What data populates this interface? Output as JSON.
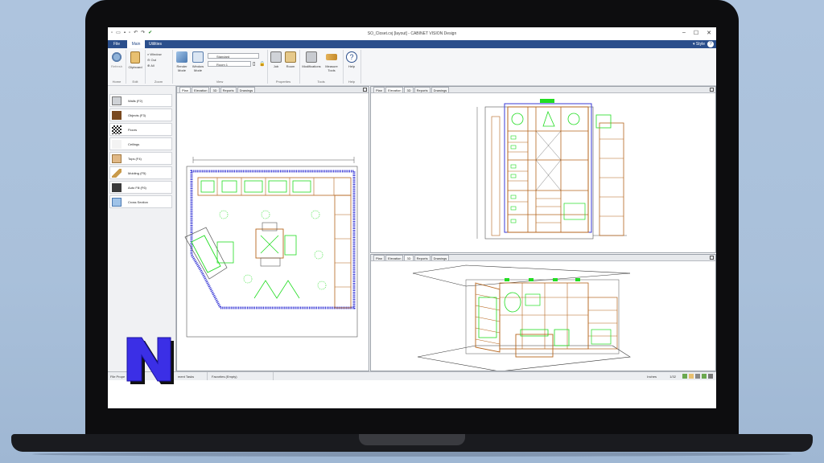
{
  "window": {
    "title": "SO_Closet.cvj [layout] - CABINET VISION Design",
    "minimize": "–",
    "maximize": "☐",
    "close": "✕"
  },
  "ribbon_tabs": [
    {
      "label": "File"
    },
    {
      "label": "Main"
    },
    {
      "label": "Utilities"
    }
  ],
  "style_label": "▾ Style",
  "help_symbol": "?",
  "ribbon": {
    "home": {
      "refresh": "Refresh",
      "group": "Home"
    },
    "edit": {
      "clipboard": "Clipboard",
      "group": "Edit"
    },
    "zoom": {
      "window": "Window",
      "out": "Out",
      "all": "All",
      "group": "Zoom"
    },
    "view": {
      "render_mode": "Render Mode",
      "window_mode": "Window Mode",
      "combo_style": "Standard",
      "combo_room": "Room 1",
      "group": "View"
    },
    "properties": {
      "job": "Job",
      "room": "Room",
      "group": "Properties"
    },
    "tools": {
      "modifications": "Modifications",
      "measure_tools": "Measure Tools",
      "group": "Tools"
    },
    "help": {
      "help": "Help",
      "group": "Help"
    }
  },
  "left_panel": {
    "items": [
      {
        "label": "Walls (F2)"
      },
      {
        "label": "Objects (F3)"
      },
      {
        "label": "Floors"
      },
      {
        "label": "Ceilings"
      },
      {
        "label": "Tops (F4)"
      },
      {
        "label": "Molding (F5)"
      },
      {
        "label": "Auto Fill (F6)"
      },
      {
        "label": "Cross Section"
      }
    ]
  },
  "viewport_tabs": [
    "Plan",
    "Elevation",
    "3D",
    "Reports",
    "Drawings"
  ],
  "status_bar": {
    "left": "File Prope",
    "middle": "ment Tasks",
    "favorites": "Favorites (Empty)",
    "units": "Inches",
    "scale": "1/32"
  },
  "colors": {
    "ribbon_blue": "#2b4f8c",
    "cabinet_orange": "#b5651d",
    "accessory_green": "#22dd22",
    "wall_blue": "#3a3ad6"
  }
}
